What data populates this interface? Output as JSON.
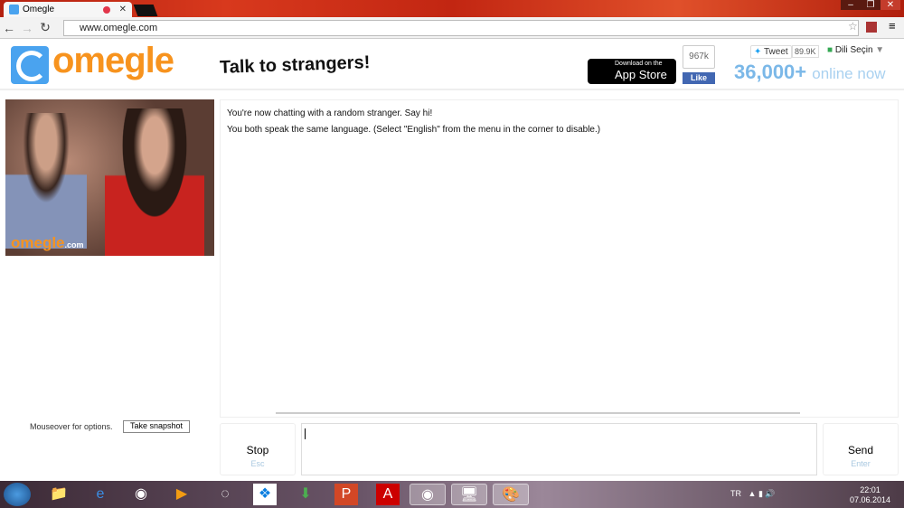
{
  "browser": {
    "tab_title": "Omegle",
    "url": "www.omegle.com"
  },
  "header": {
    "logo": "omegle",
    "tagline": "Talk to strangers!",
    "appstore_small": "Download on the",
    "appstore_big": "App Store",
    "fb_count": "967k",
    "fb_like": "Like",
    "tweet": "Tweet",
    "tweet_count": "89.9K",
    "language": "Dili Seçin",
    "online_count": "36,000+",
    "online_label": "online now"
  },
  "video": {
    "watermark": "omegle",
    "watermark_suffix": ".com"
  },
  "chat": {
    "messages": [
      "You're now chatting with a random stranger. Say hi!",
      "You both speak the same language. (Select \"English\" from the menu in the corner to disable.)"
    ]
  },
  "controls": {
    "mouseover": "Mouseover for options.",
    "snapshot": "Take snapshot",
    "stop": "Stop",
    "stop_key": "Esc",
    "send": "Send",
    "send_key": "Enter",
    "message_value": ""
  },
  "taskbar": {
    "lang": "TR",
    "time": "22:01",
    "date": "07.06.2014",
    "apps": [
      "explorer-icon",
      "ie-icon",
      "chrome-icon",
      "media-player-icon",
      "app-icon",
      "dropbox-icon",
      "download-manager-icon",
      "powerpoint-icon",
      "acrobat-icon",
      "chrome-icon",
      "remote-desktop-icon",
      "paint-icon"
    ]
  },
  "colors": {
    "brand_orange": "#f7931e",
    "brand_blue": "#4aa3ef",
    "online_blue": "#8ec1ea"
  }
}
